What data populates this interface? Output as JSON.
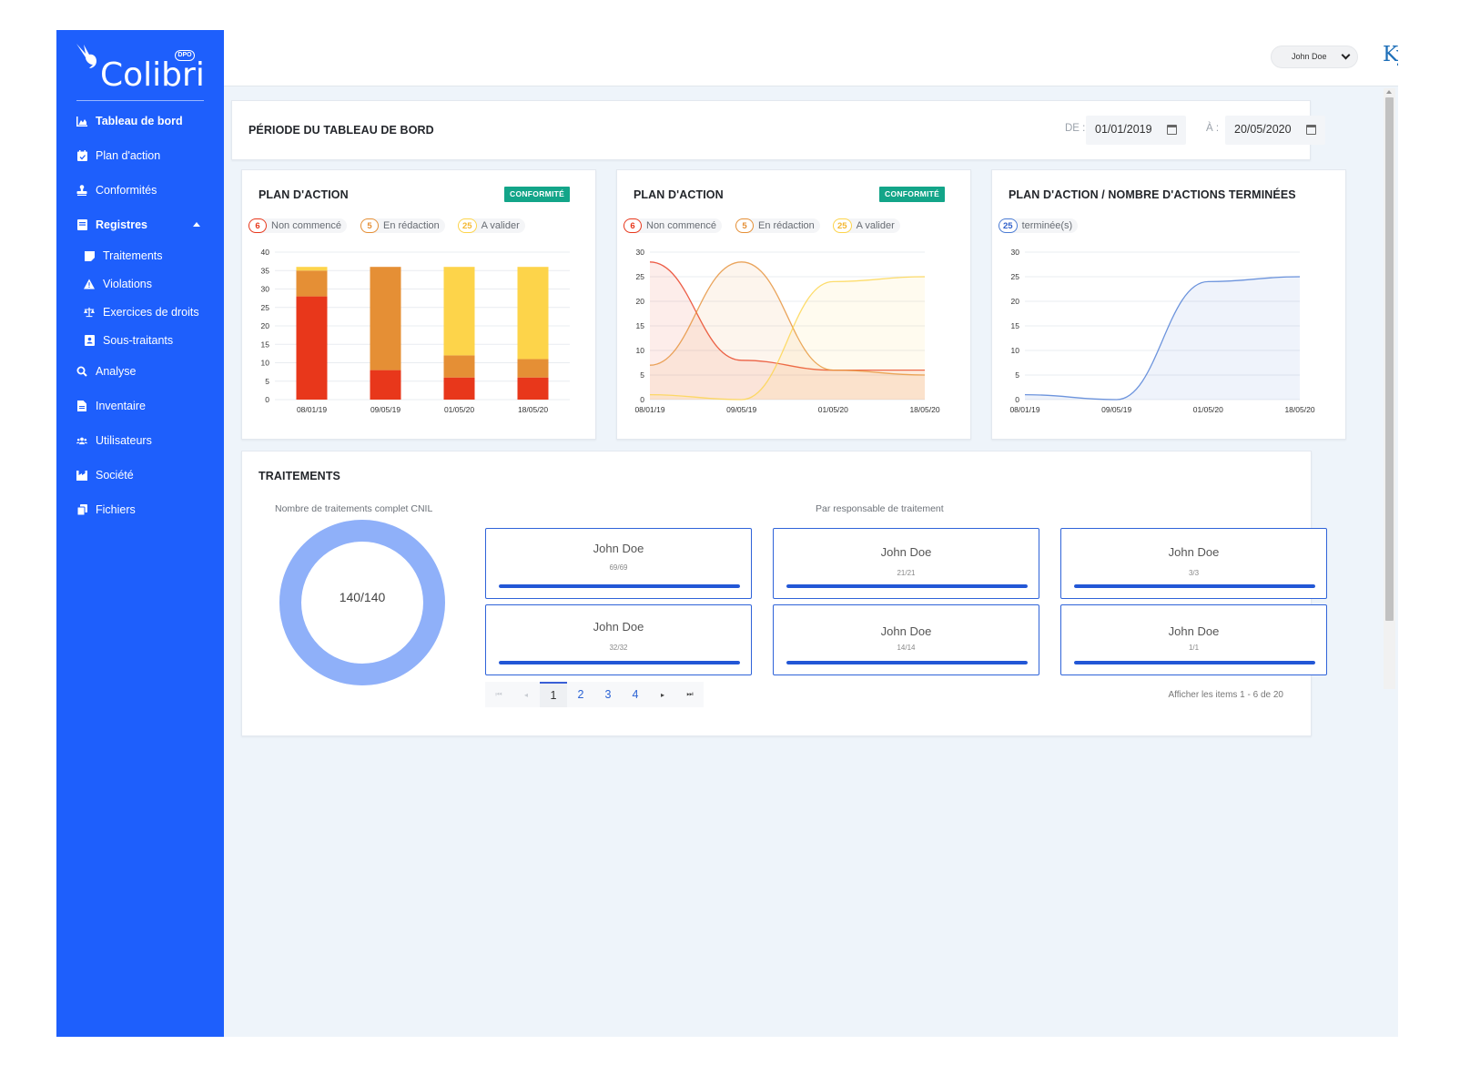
{
  "app": {
    "logo_text": "Colibri",
    "logo_badge": "DPO",
    "brand": "Kyoss"
  },
  "header": {
    "user_select": "John Doe"
  },
  "sidebar": {
    "items": [
      {
        "label": "Tableau de bord",
        "icon": "chart-area-icon"
      },
      {
        "label": "Plan d'action",
        "icon": "calendar-check-icon"
      },
      {
        "label": "Conformités",
        "icon": "stamp-icon"
      },
      {
        "label": "Registres",
        "icon": "book-icon"
      },
      {
        "label": "Traitements",
        "icon": "sticky-note-icon"
      },
      {
        "label": "Violations",
        "icon": "warning-icon"
      },
      {
        "label": "Exercices de droits",
        "icon": "balance-scale-icon"
      },
      {
        "label": "Sous-traitants",
        "icon": "address-book-icon"
      },
      {
        "label": "Analyse",
        "icon": "search-icon"
      },
      {
        "label": "Inventaire",
        "icon": "file-icon"
      },
      {
        "label": "Utilisateurs",
        "icon": "users-icon"
      },
      {
        "label": "Société",
        "icon": "industry-icon"
      },
      {
        "label": "Fichiers",
        "icon": "copy-icon"
      }
    ]
  },
  "period": {
    "title": "PÉRIODE DU TABLEAU DE BORD",
    "from_label": "DE :",
    "from_value": "01/01/2019",
    "to_label": "À :",
    "to_value": "20/05/2020"
  },
  "charts_header": {
    "plan1_title": "PLAN D'ACTION",
    "plan1_badge": "CONFORMITÉ",
    "plan2_title": "PLAN D'ACTION",
    "plan2_badge": "CONFORMITÉ",
    "plan3_title": "PLAN D'ACTION / NOMBRE D'ACTIONS TERMINÉES"
  },
  "legend": {
    "non_commence": {
      "count": "6",
      "label": "Non commencé"
    },
    "en_redaction": {
      "count": "5",
      "label": "En rédaction"
    },
    "a_valider": {
      "count": "25",
      "label": "A valider"
    },
    "terminees": {
      "count": "25",
      "label": "terminée(s)"
    }
  },
  "colors": {
    "sidebar": "#1e5ffc",
    "non_commence": "#e8371b",
    "en_redaction": "#e58f35",
    "a_valider": "#fdd44a",
    "terminees": "#4a7bd4",
    "badge": "#13a589",
    "donut": "#8fb0f9"
  },
  "chart_data": [
    {
      "type": "bar",
      "stacked": true,
      "categories": [
        "08/01/19",
        "09/05/19",
        "01/05/20",
        "18/05/20"
      ],
      "series": [
        {
          "name": "Non commencé",
          "values": [
            28,
            8,
            6,
            6
          ]
        },
        {
          "name": "En rédaction",
          "values": [
            7,
            28,
            6,
            5
          ]
        },
        {
          "name": "A valider",
          "values": [
            1,
            0,
            24,
            25
          ]
        }
      ],
      "ylim": [
        0,
        40
      ],
      "yticks": [
        0,
        5,
        10,
        15,
        20,
        25,
        30,
        35,
        40
      ],
      "grid": true
    },
    {
      "type": "area",
      "categories": [
        "08/01/19",
        "09/05/19",
        "01/05/20",
        "18/05/20"
      ],
      "series": [
        {
          "name": "Non commencé",
          "values": [
            28,
            8,
            6,
            6
          ]
        },
        {
          "name": "En rédaction",
          "values": [
            7,
            28,
            6,
            5
          ]
        },
        {
          "name": "A valider",
          "values": [
            1,
            0,
            24,
            25
          ]
        }
      ],
      "ylim": [
        0,
        30
      ],
      "yticks": [
        0,
        5,
        10,
        15,
        20,
        25,
        30
      ],
      "grid": true
    },
    {
      "type": "area",
      "categories": [
        "08/01/19",
        "09/05/19",
        "01/05/20",
        "18/05/20"
      ],
      "series": [
        {
          "name": "terminée(s)",
          "values": [
            1,
            0,
            24,
            25
          ]
        }
      ],
      "ylim": [
        0,
        30
      ],
      "yticks": [
        0,
        5,
        10,
        15,
        20,
        25,
        30
      ],
      "grid": true
    }
  ],
  "traitements": {
    "title": "TRAITEMENTS",
    "donut_title": "Nombre de traitements complet CNIL",
    "donut_value": "140/140",
    "donut_fraction": 1,
    "resp_title": "Par responsable de traitement",
    "responsables": [
      {
        "name": "John Doe",
        "count": "69/69",
        "progress": 1
      },
      {
        "name": "John Doe",
        "count": "21/21",
        "progress": 1
      },
      {
        "name": "John Doe",
        "count": "3/3",
        "progress": 1
      },
      {
        "name": "John Doe",
        "count": "32/32",
        "progress": 1
      },
      {
        "name": "John Doe",
        "count": "14/14",
        "progress": 1
      },
      {
        "name": "John Doe",
        "count": "1/1",
        "progress": 1
      }
    ],
    "pager": {
      "first": "⏮",
      "prev": "◂",
      "pages": [
        "1",
        "2",
        "3",
        "4"
      ],
      "next": "▸",
      "last": "⏭",
      "current": "1"
    },
    "items_info": "Afficher les items 1 - 6 de 20"
  }
}
